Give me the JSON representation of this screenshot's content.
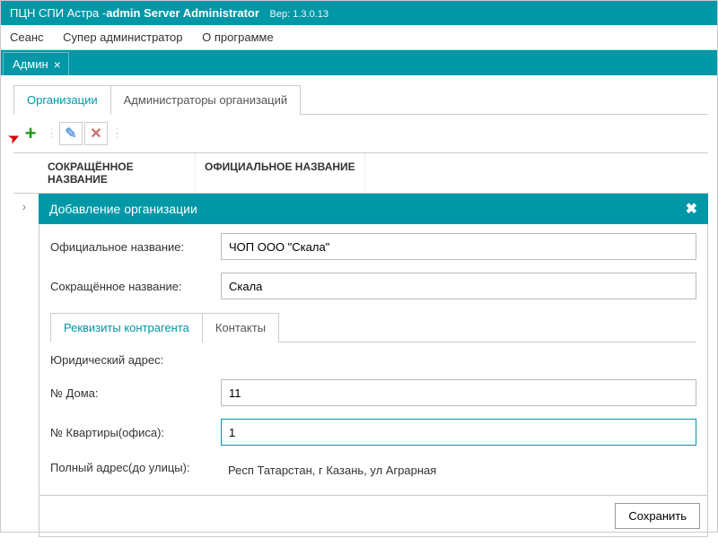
{
  "titlebar": {
    "prefix": "ПЦН СПИ Астра -",
    "suffix": "admin Server Administrator",
    "version_label": "Вер: 1.3.0.13"
  },
  "menubar": {
    "items": [
      "Сеанс",
      "Супер администратор",
      "О программе"
    ]
  },
  "doctab": {
    "label": "Админ"
  },
  "subtabs": {
    "items": [
      "Организации",
      "Администраторы организаций"
    ],
    "active": 0
  },
  "grid": {
    "col1": "СОКРАЩЁННОЕ НАЗВАНИЕ",
    "col2": "ОФИЦИАЛЬНОЕ НАЗВАНИЕ"
  },
  "panel": {
    "title": "Добавление организации",
    "official_label": "Официальное название:",
    "official_value": "ЧОП ООО \"Скала\"",
    "short_label": "Сокращённое название:",
    "short_value": "Скала",
    "inner_tabs": [
      "Реквизиты контрагента",
      "Контакты"
    ],
    "legal_addr_label": "Юридический адрес:",
    "house_label": "№ Дома:",
    "house_value": "11",
    "apt_label": "№ Квартиры(офиса):",
    "apt_value": "1",
    "full_addr_label": "Полный адрес(до улицы):",
    "full_addr_value": "Респ Татарстан, г Казань, ул Аграрная",
    "save_label": "Сохранить"
  }
}
